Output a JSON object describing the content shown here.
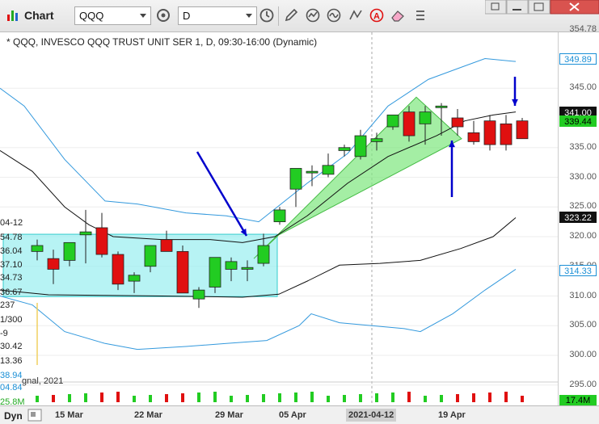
{
  "toolbar": {
    "title": "Chart",
    "symbol": "QQQ",
    "interval": "D",
    "icons": [
      "chart-icon",
      "settings-icon",
      "clock-icon",
      "pencil-icon",
      "indicator-icon",
      "indicator-alt-icon",
      "text-icon",
      "eraser-icon",
      "list-icon"
    ]
  },
  "window": {
    "buttons": [
      "restore",
      "minimize",
      "maximize",
      "close"
    ]
  },
  "chart": {
    "subtitle": "* QQQ, INVESCO QQQ TRUST UNIT SER 1, D, 09:30-16:00 (Dynamic)",
    "colors": {
      "up": "#22cc22",
      "down": "#e01010",
      "bands": "#3399dd",
      "mid": "#111111",
      "arrow": "#0000cc",
      "channel": "#7ee77e",
      "box": "#99eef0"
    },
    "price_ticks": [
      "354.78",
      "345.00",
      "335.00",
      "330.00",
      "325.00",
      "320.00",
      "315.00",
      "310.00",
      "305.00",
      "300.00",
      "295.00"
    ],
    "price_labels": [
      {
        "text": "349.89",
        "color": "#1a8fd6",
        "bg": "#ffffff",
        "border": "#1a8fd6",
        "value": 349.89
      },
      {
        "text": "341.00",
        "color": "#ffffff",
        "bg": "#111111",
        "border": "#111111",
        "value": 341.0
      },
      {
        "text": "339.44",
        "color": "#000000",
        "bg": "#22cc22",
        "border": "#22cc22",
        "value": 339.44
      },
      {
        "text": "323.22",
        "color": "#ffffff",
        "bg": "#111111",
        "border": "#111111",
        "value": 323.22
      },
      {
        "text": "314.33",
        "color": "#1a8fd6",
        "bg": "#ffffff",
        "border": "#1a8fd6",
        "value": 314.33
      }
    ],
    "volume_label": "17.4M",
    "left_labels": [
      "04-12",
      "54.78",
      "36.04",
      "37.10",
      "34.73",
      "36.67",
      "237",
      "1/300",
      "-9",
      "30.42",
      "13.36",
      "38.94",
      "04.84",
      "25.8M",
      "gnal, 2021"
    ],
    "dates": [
      "15 Mar",
      "22 Mar",
      "29 Mar",
      "05 Apr",
      "2021-04-12",
      "19 Apr"
    ],
    "dyn_label": "Dyn",
    "candles": [
      [
        317.5,
        319.5,
        316.0,
        318.5
      ],
      [
        316.3,
        317.8,
        312.0,
        314.5
      ],
      [
        316.0,
        318.0,
        315.0,
        319.0
      ],
      [
        320.3,
        324.5,
        315.5,
        320.8
      ],
      [
        321.5,
        324.0,
        316.5,
        317.0
      ],
      [
        317.0,
        317.5,
        311.0,
        312.0
      ],
      [
        312.5,
        314.0,
        310.5,
        313.5
      ],
      [
        315.0,
        318.5,
        314.0,
        318.5
      ],
      [
        319.5,
        321.0,
        318.0,
        317.5
      ],
      [
        317.5,
        318.5,
        310.5,
        310.5
      ],
      [
        309.5,
        311.5,
        308.0,
        311.0
      ],
      [
        311.5,
        316.5,
        310.5,
        316.5
      ],
      [
        314.5,
        316.5,
        312.5,
        315.8
      ],
      [
        314.5,
        316.0,
        312.5,
        314.8
      ],
      [
        315.5,
        320.5,
        315.0,
        318.5
      ],
      [
        322.5,
        325.0,
        322.0,
        324.5
      ],
      [
        328.0,
        331.0,
        325.0,
        331.5
      ],
      [
        331.0,
        332.0,
        328.5,
        331.0
      ],
      [
        330.5,
        334.0,
        330.0,
        332.0
      ],
      [
        334.5,
        335.5,
        333.5,
        335.0
      ],
      [
        333.5,
        338.0,
        333.0,
        337.0
      ],
      [
        336.0,
        337.5,
        334.5,
        336.5
      ],
      [
        338.5,
        340.5,
        338.0,
        340.5
      ],
      [
        341.0,
        342.0,
        336.0,
        337.0
      ],
      [
        339.0,
        342.0,
        335.5,
        341.0
      ],
      [
        342.0,
        342.5,
        337.0,
        342.0
      ],
      [
        340.0,
        341.5,
        337.0,
        338.5
      ],
      [
        337.5,
        339.5,
        335.5,
        336.0
      ],
      [
        339.5,
        340.5,
        334.5,
        335.5
      ],
      [
        339.0,
        340.5,
        334.5,
        335.5
      ],
      [
        339.5,
        340.0,
        336.5,
        336.5
      ]
    ]
  }
}
